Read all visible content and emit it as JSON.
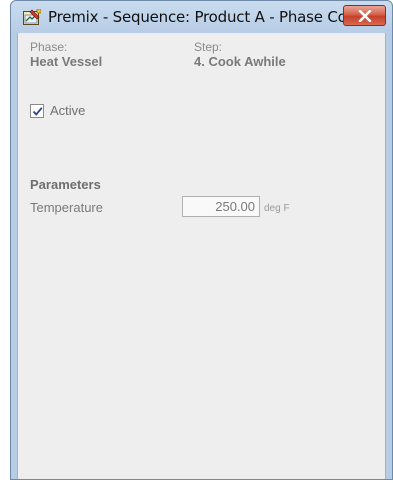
{
  "window": {
    "title": "Premix - Sequence: Product A - Phase Co...",
    "close_icon": "close-icon",
    "app_icon": "premix-app-icon"
  },
  "header": {
    "phase_label": "Phase:",
    "phase_value": "Heat Vessel",
    "step_label": "Step:",
    "step_value": "4. Cook Awhile"
  },
  "active": {
    "label": "Active",
    "checked": true
  },
  "parameters": {
    "title": "Parameters",
    "items": [
      {
        "label": "Temperature",
        "value": "250.00",
        "unit": "deg F"
      }
    ]
  },
  "colors": {
    "titlebar": "#b7cde6",
    "client_bg": "#eeeeee",
    "close_button": "#c5402a",
    "check": "#2a4a7a"
  }
}
